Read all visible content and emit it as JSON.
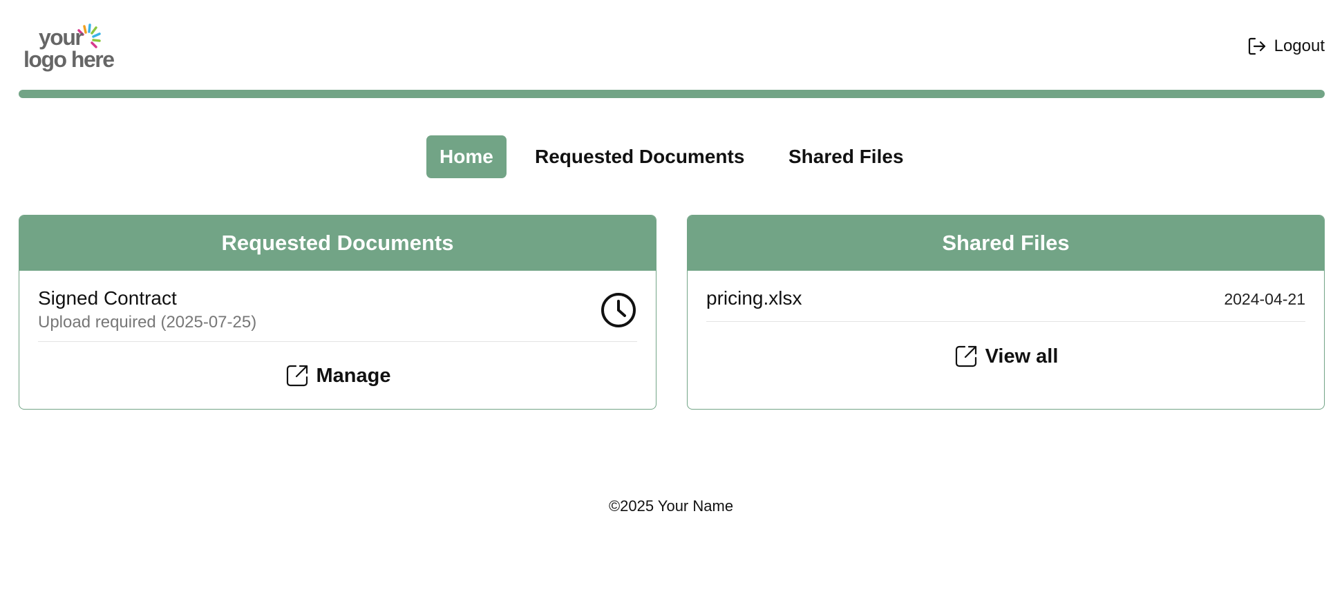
{
  "logo": {
    "line1": "your",
    "line2": "logo here"
  },
  "header": {
    "logout_label": "Logout"
  },
  "colors": {
    "accent": "#72a486",
    "muted_text": "#777777"
  },
  "nav": {
    "tabs": [
      {
        "label": "Home",
        "active": true
      },
      {
        "label": "Requested Documents",
        "active": false
      },
      {
        "label": "Shared Files",
        "active": false
      }
    ]
  },
  "requested_card": {
    "title": "Requested Documents",
    "items": [
      {
        "title": "Signed Contract",
        "subtitle": "Upload required (2025-07-25)",
        "icon": "clock-icon"
      }
    ],
    "action_label": "Manage",
    "action_icon": "external-link-icon"
  },
  "shared_card": {
    "title": "Shared Files",
    "items": [
      {
        "name": "pricing.xlsx",
        "date": "2024-04-21"
      }
    ],
    "action_label": "View all",
    "action_icon": "external-link-icon"
  },
  "footer": {
    "text": "©2025 Your Name"
  }
}
